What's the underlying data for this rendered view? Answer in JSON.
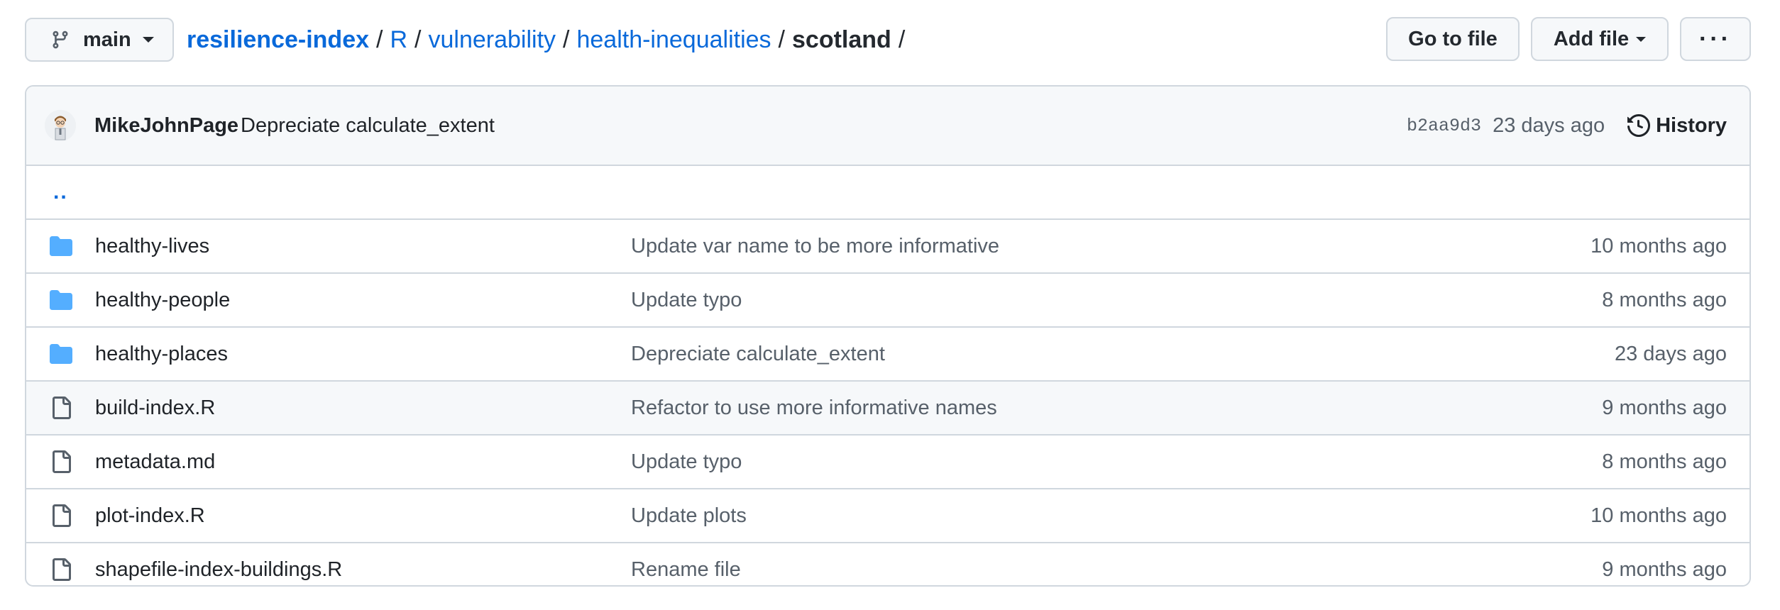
{
  "branch": {
    "name": "main",
    "icon": "git-branch-icon"
  },
  "breadcrumb": {
    "repo": "resilience-index",
    "dirs": [
      "R",
      "vulnerability",
      "health-inequalities"
    ],
    "current": "scotland",
    "separator": "/"
  },
  "actions": {
    "go_to_file": "Go to file",
    "add_file": "Add file",
    "more": "···"
  },
  "latest_commit": {
    "author": "MikeJohnPage",
    "message": "Depreciate calculate_extent",
    "sha": "b2aa9d3",
    "time": "23 days ago",
    "history_label": "History"
  },
  "parent_dir": "..",
  "files": [
    {
      "type": "dir",
      "name": "healthy-lives",
      "message": "Update var name to be more informative",
      "age": "10 months ago"
    },
    {
      "type": "dir",
      "name": "healthy-people",
      "message": "Update typo",
      "age": "8 months ago"
    },
    {
      "type": "dir",
      "name": "healthy-places",
      "message": "Depreciate calculate_extent",
      "age": "23 days ago"
    },
    {
      "type": "file",
      "name": "build-index.R",
      "message": "Refactor to use more informative names",
      "age": "9 months ago"
    },
    {
      "type": "file",
      "name": "metadata.md",
      "message": "Update typo",
      "age": "8 months ago"
    },
    {
      "type": "file",
      "name": "plot-index.R",
      "message": "Update plots",
      "age": "10 months ago"
    },
    {
      "type": "file",
      "name": "shapefile-index-buildings.R",
      "message": "Rename file",
      "age": "9 months ago"
    }
  ],
  "colors": {
    "link": "#0969da",
    "folder": "#54aeff",
    "muted": "#57606a",
    "border": "#d0d7de",
    "header_bg": "#f6f8fa"
  }
}
